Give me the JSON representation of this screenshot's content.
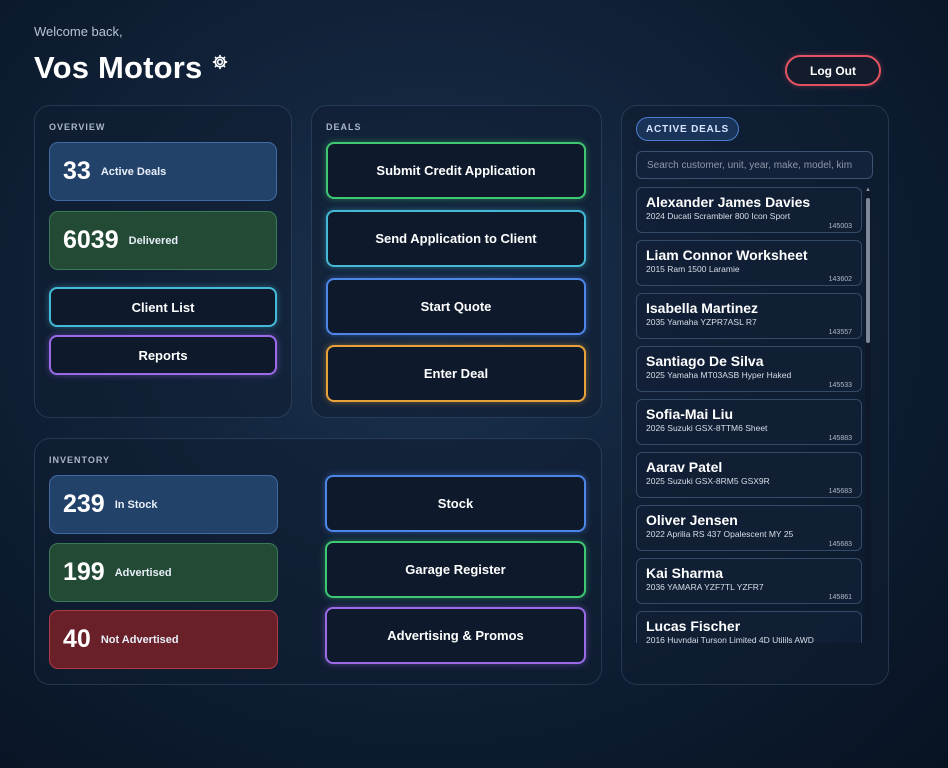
{
  "header": {
    "welcome": "Welcome back,",
    "title": "Vos Motors",
    "logout_label": "Log Out"
  },
  "overview": {
    "label": "OVERVIEW",
    "stats": [
      {
        "value": "33",
        "label": "Active Deals"
      },
      {
        "value": "6039",
        "label": "Delivered"
      }
    ],
    "buttons": [
      "Client List",
      "Reports"
    ]
  },
  "deals": {
    "label": "DEALS",
    "buttons": [
      "Submit Credit Application",
      "Send Application to Client",
      "Start Quote",
      "Enter Deal"
    ]
  },
  "inventory": {
    "label": "INVENTORY",
    "stats": [
      {
        "value": "239",
        "label": "In Stock"
      },
      {
        "value": "199",
        "label": "Advertised"
      },
      {
        "value": "40",
        "label": "Not Advertised"
      }
    ],
    "buttons": [
      "Stock",
      "Garage Register",
      "Advertising & Promos"
    ]
  },
  "active_deals": {
    "label": "ACTIVE DEALS",
    "search_placeholder": "Search customer, unit, year, make, model, kim",
    "items": [
      {
        "name": "Alexander James Davies",
        "vehicle": "2024 Ducati Scrambler 800 Icon Sport",
        "id": "145003"
      },
      {
        "name": "Liam Connor Worksheet",
        "vehicle": "2015 Ram 1500 Laramie",
        "id": "143602"
      },
      {
        "name": "Isabella Martinez",
        "vehicle": "2035 Yamaha YZPR7ASL R7",
        "id": "143557"
      },
      {
        "name": "Santiago De Silva",
        "vehicle": "2025 Yamaha MT03ASB Hyper Haked",
        "id": "145533"
      },
      {
        "name": "Sofia-Mai Liu",
        "vehicle": "2026 Suzuki GSX-8TTM6 Sheet",
        "id": "145883"
      },
      {
        "name": "Aarav Patel",
        "vehicle": "2025 Suzuki GSX-8RM5 GSX9R",
        "id": "145683"
      },
      {
        "name": "Oliver Jensen",
        "vehicle": "2022 Aprilia RS 437 Opalescent MY 25",
        "id": "145683"
      },
      {
        "name": "Kai Sharma",
        "vehicle": "2036 YAMARA YZF7TL YZFR7",
        "id": "145861"
      },
      {
        "name": "Lucas Fischer",
        "vehicle": "2016 Huyndai Turson Limited 4D Utilils AWD",
        "id": ""
      }
    ]
  },
  "colors": {
    "green": "#3ec874",
    "teal": "#45b9d6",
    "blue": "#4d86e8",
    "orange": "#e8a23a",
    "purple": "#9a6ae8",
    "logout": "#e25262"
  },
  "icons": {
    "settings": "gear-icon"
  }
}
